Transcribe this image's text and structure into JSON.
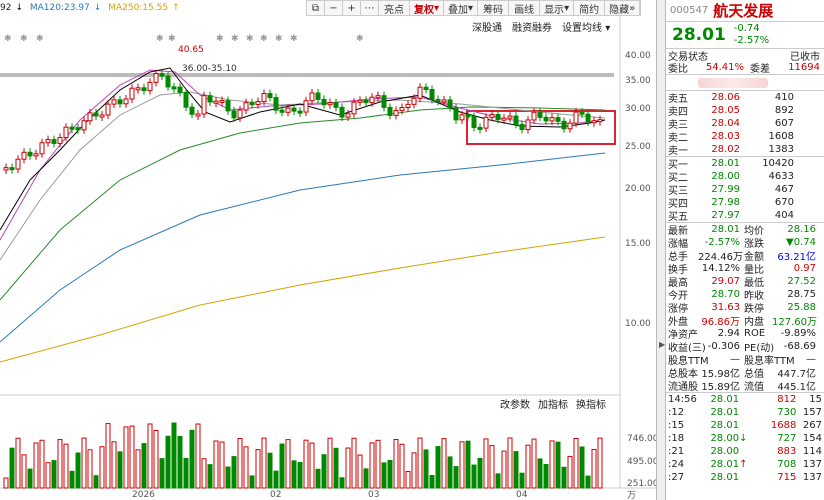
{
  "legend": {
    "ma1": "92",
    "ma120": "MA120:23.97",
    "ma250": "MA250:15.55"
  },
  "toolbar": [
    "亮点",
    "复权",
    "叠加",
    "筹码",
    "画线",
    "显示",
    "简约",
    "隐藏"
  ],
  "links": {
    "a": "深股通",
    "b": "融资融券",
    "c": "设置均线"
  },
  "annotations": {
    "high": "40.65",
    "range": "36.00-35.10"
  },
  "yaxis": [
    "40.00",
    "35.00",
    "30.00",
    "25.00",
    "20.00",
    "15.00",
    "10.00"
  ],
  "vol_axis": [
    "746.00",
    "495.00",
    "251.00",
    "万"
  ],
  "vol_tools": [
    "改参数",
    "加指标",
    "换指标"
  ],
  "xaxis": [
    "2026",
    "02",
    "03",
    "04"
  ],
  "stock": {
    "code": "000547",
    "name": "航天发展",
    "price": "28.01",
    "change": "-0.74",
    "pct": "-2.57%"
  },
  "status": {
    "label": "交易状态",
    "value": "已收市"
  },
  "ratio": {
    "l1": "委比",
    "v1": "54.41%",
    "l2": "委差",
    "v2": "11694"
  },
  "asks": [
    {
      "label": "卖五",
      "price": "28.06",
      "vol": "410"
    },
    {
      "label": "卖四",
      "price": "28.05",
      "vol": "892"
    },
    {
      "label": "卖三",
      "price": "28.04",
      "vol": "607"
    },
    {
      "label": "卖二",
      "price": "28.03",
      "vol": "1608"
    },
    {
      "label": "卖一",
      "price": "28.02",
      "vol": "1383"
    }
  ],
  "bids": [
    {
      "label": "买一",
      "price": "28.01",
      "vol": "10420"
    },
    {
      "label": "买二",
      "price": "28.00",
      "vol": "4633"
    },
    {
      "label": "买三",
      "price": "27.99",
      "vol": "467"
    },
    {
      "label": "买四",
      "price": "27.98",
      "vol": "670"
    },
    {
      "label": "买五",
      "price": "27.97",
      "vol": "404"
    }
  ],
  "stats": [
    {
      "l1": "最新",
      "v1": "28.01",
      "l2": "均价",
      "v2": "28.16"
    },
    {
      "l1": "涨幅",
      "v1": "-2.57%",
      "l2": "涨跌",
      "v2": "▼0.74"
    },
    {
      "l1": "总手",
      "v1": "224.46万",
      "l2": "金额",
      "v2": "63.21亿"
    },
    {
      "l1": "换手",
      "v1": "14.12%",
      "l2": "量比",
      "v2": "0.97"
    },
    {
      "l1": "最高",
      "v1": "29.07",
      "l2": "最低",
      "v2": "27.52"
    },
    {
      "l1": "今开",
      "v1": "28.70",
      "l2": "昨收",
      "v2": "28.75"
    },
    {
      "l1": "涨停",
      "v1": "31.63",
      "l2": "跌停",
      "v2": "25.88"
    },
    {
      "l1": "外盘",
      "v1": "96.86万",
      "l2": "内盘",
      "v2": "127.60万"
    },
    {
      "l1": "净资产",
      "v1": "2.94",
      "l2": "ROE",
      "v2": "-9.89%"
    },
    {
      "l1": "收益(三)",
      "v1": "-0.306",
      "l2": "PE(动)",
      "v2": "-68.69"
    },
    {
      "l1": "股息TTM",
      "v1": "—",
      "l2": "股息率TTM",
      "v2": "—"
    },
    {
      "l1": "总股本",
      "v1": "15.98亿",
      "l2": "总值",
      "v2": "447.7亿"
    },
    {
      "l1": "流通股",
      "v1": "15.89亿",
      "l2": "流值",
      "v2": "445.1亿"
    }
  ],
  "ticks": [
    {
      "t": "14:56",
      "p": "28.01",
      "a": "",
      "v": "812",
      "n": "15"
    },
    {
      "t": ":12",
      "p": "28.01",
      "a": "",
      "v": "730",
      "n": "157"
    },
    {
      "t": ":15",
      "p": "28.01",
      "a": "",
      "v": "1688",
      "n": "267"
    },
    {
      "t": ":18",
      "p": "28.00",
      "a": "↓",
      "v": "727",
      "n": "154"
    },
    {
      "t": ":21",
      "p": "28.00",
      "a": "",
      "v": "883",
      "n": "114"
    },
    {
      "t": ":24",
      "p": "28.01",
      "a": "↑",
      "v": "708",
      "n": "137"
    },
    {
      "t": ":27",
      "p": "28.01",
      "a": "",
      "v": "715",
      "n": "137"
    }
  ],
  "colors": {
    "up": "#cc0000",
    "down": "#008800",
    "ma5": "#000000",
    "ma10": "#c040c0",
    "ma20": "#999999",
    "ma60": "#2a8a2a",
    "ma120": "#2a7ab8",
    "ma250": "#d4a400"
  }
}
